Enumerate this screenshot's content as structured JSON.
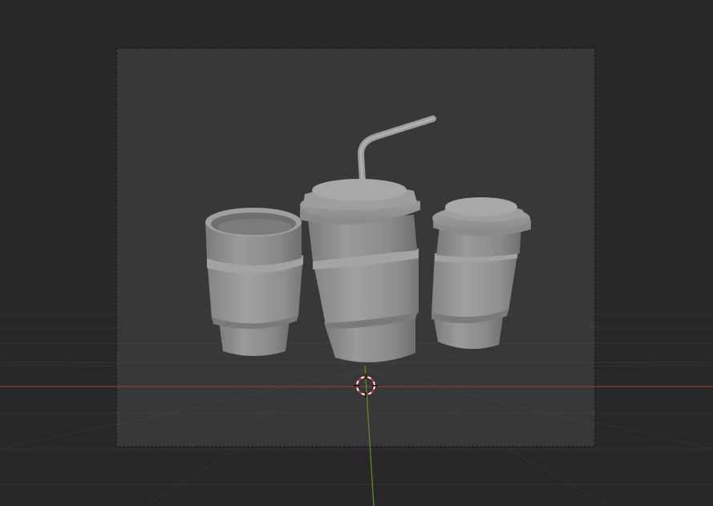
{
  "viewport": {
    "background_color": "#282828",
    "camera_frame_color": "#383838",
    "camera_border_color": "#111111",
    "grid_color": "#3a3a3a",
    "x_axis_color": "#8a3a3a",
    "y_axis_color": "#5f8a2a",
    "model_color": "#8e8e8e"
  },
  "scene": {
    "objects": [
      {
        "name": "open-coffee-cup"
      },
      {
        "name": "soda-cup-with-straw"
      },
      {
        "name": "lidded-coffee-cup"
      }
    ]
  },
  "cursor": {
    "icon": "3d-cursor-icon"
  }
}
